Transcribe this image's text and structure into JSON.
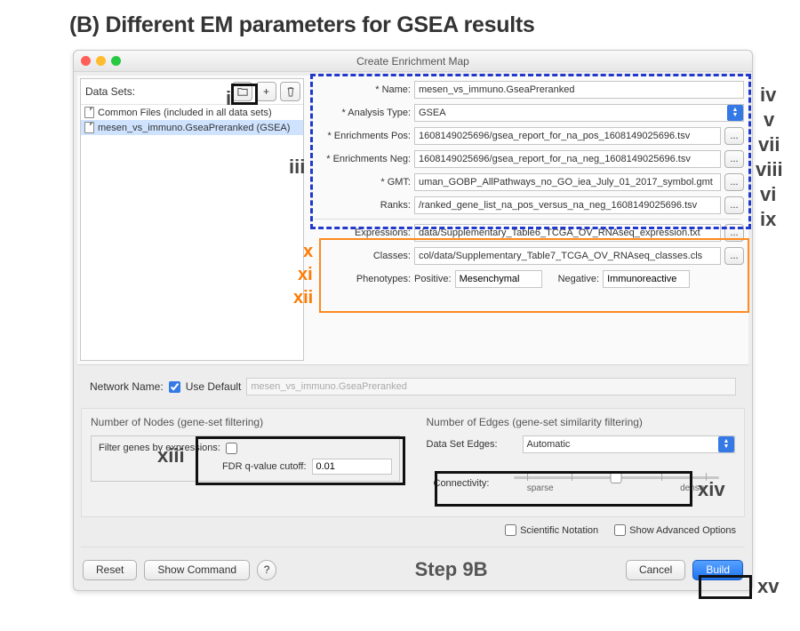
{
  "figure_title": "(B) Different EM parameters for GSEA results",
  "window_title": "Create Enrichment Map",
  "datasets": {
    "label": "Data Sets:",
    "items": [
      {
        "text": "Common Files (included in all data sets)",
        "selected": false
      },
      {
        "text": "mesen_vs_immuno.GseaPreranked  (GSEA)",
        "selected": true
      }
    ]
  },
  "form": {
    "name_label": "* Name:",
    "name_value": "mesen_vs_immuno.GseaPreranked",
    "analysis_label": "* Analysis Type:",
    "analysis_value": "GSEA",
    "enrich_pos_label": "* Enrichments Pos:",
    "enrich_pos_value": "1608149025696/gsea_report_for_na_pos_1608149025696.tsv",
    "enrich_neg_label": "* Enrichments Neg:",
    "enrich_neg_value": "1608149025696/gsea_report_for_na_neg_1608149025696.tsv",
    "gmt_label": "* GMT:",
    "gmt_value": "uman_GOBP_AllPathways_no_GO_iea_July_01_2017_symbol.gmt",
    "ranks_label": "Ranks:",
    "ranks_value": "/ranked_gene_list_na_pos_versus_na_neg_1608149025696.tsv",
    "expr_label": "Expressions:",
    "expr_value": "data/Supplementary_Table6_TCGA_OV_RNAseq_expression.txt",
    "classes_label": "Classes:",
    "classes_value": "col/data/Supplementary_Table7_TCGA_OV_RNAseq_classes.cls",
    "phen_label": "Phenotypes:",
    "phen_pos_label": "Positive:",
    "phen_pos_value": "Mesenchymal",
    "phen_neg_label": "Negative:",
    "phen_neg_value": "Immunoreactive",
    "browse": "..."
  },
  "network": {
    "label": "Network Name:",
    "use_default_label": "Use Default",
    "use_default_checked": true,
    "value": "mesen_vs_immuno.GseaPreranked"
  },
  "nodes_panel": {
    "title": "Number of Nodes (gene-set filtering)",
    "filter_label": "Filter genes by expressions:",
    "filter_checked": false,
    "fdr_label": "FDR q-value cutoff:",
    "fdr_value": "0.01"
  },
  "edges_panel": {
    "title": "Number of Edges (gene-set similarity filtering)",
    "dse_label": "Data Set Edges:",
    "dse_value": "Automatic",
    "conn_label": "Connectivity:",
    "sparse": "sparse",
    "dense": "dense"
  },
  "options": {
    "sci_label": "Scientific Notation",
    "adv_label": "Show Advanced Options"
  },
  "footer": {
    "reset": "Reset",
    "show_cmd": "Show Command",
    "help": "?",
    "step": "Step 9B",
    "cancel": "Cancel",
    "build": "Build"
  },
  "annotations": {
    "i": "i",
    "iii": "iii",
    "iv": "iv",
    "v": "v",
    "vi": "vi",
    "vii": "vii",
    "viii": "viii",
    "ix": "ix",
    "x": "x",
    "xi": "xi",
    "xii": "xii",
    "xiii": "xiii",
    "xiv": "xiv",
    "xv": "xv"
  }
}
